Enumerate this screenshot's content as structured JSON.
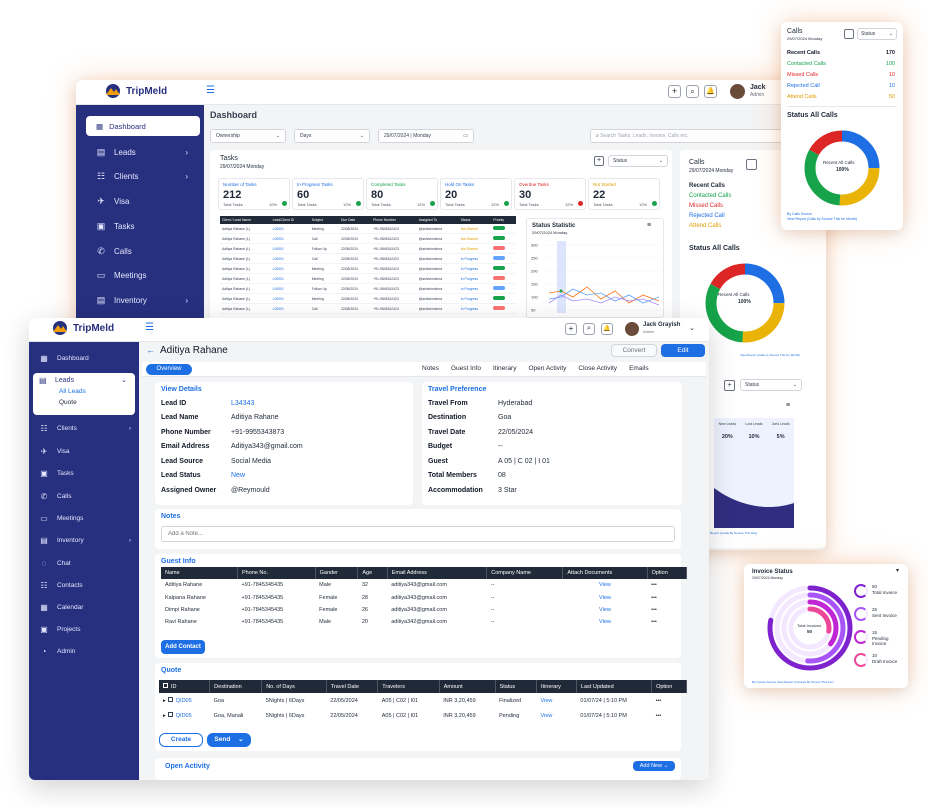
{
  "colors": {
    "sidebar": "#27307f",
    "accent": "#1d6fe3",
    "green": "#16a34a",
    "red": "#dc2626",
    "orange": "#e29b00",
    "yellow": "#eab308"
  },
  "brand": {
    "name": "TripMeld"
  },
  "user": {
    "name": "Jack Grayish",
    "role": "Admin",
    "short_name": "Jack",
    "short_role": "Admin"
  },
  "back_dashboard": {
    "title": "Dashboard",
    "sidebar": [
      "Dashboard",
      "Leads",
      "Clients",
      "Visa",
      "Tasks",
      "Calls",
      "Meetings",
      "Inventory"
    ],
    "filters": {
      "ownership": "Ownership",
      "days": "Days",
      "date": "29/07/2024 | Monday",
      "search_placeholder": "Search Tasks, Leads, Invoice, Calls etc."
    },
    "tasks": {
      "title": "Tasks",
      "date": "29/07/2024 Monday",
      "status_label": "Status",
      "tiles": [
        {
          "label": "Number of Tasks",
          "value": "212",
          "sub": "Total Tasks",
          "pct": "10%"
        },
        {
          "label": "In Progress Tasks",
          "value": "60",
          "sub": "Total Tasks",
          "pct": "12%"
        },
        {
          "label": "Completed Tasks",
          "value": "80",
          "sub": "Total Tasks",
          "pct": "12%"
        },
        {
          "label": "Hold On Tasks",
          "value": "20",
          "sub": "Total Tasks",
          "pct": "12%"
        },
        {
          "label": "Overdue Tasks",
          "value": "30",
          "sub": "Total Tasks",
          "pct": "12%"
        },
        {
          "label": "Not Started",
          "value": "22",
          "sub": "Total Tasks",
          "pct": "12%"
        }
      ],
      "columns": [
        "Client / Lead Name",
        "Lead/Client ID",
        "Subject",
        "Due Date",
        "Phone Number",
        "Assigned To",
        "Status",
        "Priority"
      ],
      "rows": [
        [
          "Aditiya Rahane (L)",
          "L00001",
          "Meeting",
          "22/08/2024",
          "+91-9845342423",
          "@ashishmishra",
          "Not Started"
        ],
        [
          "Aditiya Rahane (L)",
          "L00001",
          "Call",
          "22/08/2024",
          "+91-9845342423",
          "@ashishmishra",
          "Not Started"
        ],
        [
          "Aditiya Rahane (L)",
          "L00001",
          "Follow Up",
          "22/08/2024",
          "+91-9845342423",
          "@ashishmishra",
          "Not Started"
        ],
        [
          "Aditiya Rahane (L)",
          "L00001",
          "Call",
          "22/08/2024",
          "+91-9845342423",
          "@ashishmishra",
          "In Progress"
        ],
        [
          "Aditiya Rahane (L)",
          "L00001",
          "Meeting",
          "22/08/2024",
          "+91-9845342423",
          "@ashishmishra",
          "In Progress"
        ],
        [
          "Aditiya Rahane (L)",
          "L00001",
          "Meeting",
          "22/08/2024",
          "+91-9845342423",
          "@ashishmishra",
          "In Progress"
        ],
        [
          "Aditiya Rahane (L)",
          "L00001",
          "Follow Up",
          "22/08/2024",
          "+91-9845342423",
          "@ashishmishra",
          "In Progress"
        ],
        [
          "Aditiya Rahane (L)",
          "L00001",
          "Meeting",
          "22/08/2024",
          "+91-9845342423",
          "@ashishmishra",
          "In Progress"
        ],
        [
          "Aditiya Rahane (L)",
          "L00001",
          "Call",
          "22/08/2024",
          "+91-9845342423",
          "@ashishmishra",
          "In Progress"
        ]
      ],
      "statistic_title": "Status Statistic",
      "statistic_date": "29/07/2024 Monday",
      "y_ticks": [
        "300",
        "250",
        "200",
        "150",
        "100",
        "50"
      ]
    },
    "calls": {
      "title": "Calls",
      "date": "29/07/2024 Monday",
      "recent": "Recent Calls",
      "contacted": "Contacted Calls",
      "missed": "Missed Calls",
      "rejected": "Rejected Call",
      "attend": "Attend Calls",
      "status_all": "Status All Calls",
      "donut_label": "Recent All Calls",
      "donut_pct": "100%",
      "footnote": "View Report (Calls by Source This for Month)"
    },
    "leads_panel": {
      "status": "Status",
      "cols": [
        {
          "h": "New Leads",
          "v": "20%"
        },
        {
          "h": "Lost Leads",
          "v": "10%"
        },
        {
          "h": "Junk Leads",
          "v": "5%"
        }
      ],
      "footnote": "Report (Leads By Source This Day)"
    }
  },
  "calls_card": {
    "title": "Calls",
    "date": "29/07/2024 Monday",
    "status": "Status",
    "rows": [
      {
        "label": "Recent Calls",
        "value": "170"
      },
      {
        "label": "Contacted Calls",
        "value": "100"
      },
      {
        "label": "Missed Calls",
        "value": "10"
      },
      {
        "label": "Rejected Call",
        "value": "10"
      },
      {
        "label": "Attend Calls",
        "value": "50"
      }
    ],
    "status_all": "Status All Calls",
    "donut_label": "Recent All Calls",
    "donut_pct": "100%",
    "by": "By Calls Source",
    "footnote": "View Report (Calls by Source This for Month)"
  },
  "invoice_card": {
    "title": "Invoice Status",
    "date": "29/07/2024 Monday",
    "center_label": "Total Invoices",
    "center_value": "50",
    "legend": [
      {
        "value": "50",
        "label": "Total Invoice"
      },
      {
        "value": "25",
        "label": "Sent Invoice"
      },
      {
        "value": "15",
        "label": "Pending Invoice"
      },
      {
        "value": "10",
        "label": "Draft Invoice"
      }
    ],
    "footnote": "By Invoice Source  View Report (Invoices By Source This For)"
  },
  "lead_page": {
    "sidebar": [
      {
        "label": "Dashboard",
        "icon": "grid-icon"
      },
      {
        "label": "Leads",
        "icon": "clipboard-icon",
        "sub": [
          "All Leads",
          "Quote"
        ]
      },
      {
        "label": "Clients",
        "icon": "users-icon"
      },
      {
        "label": "Visa",
        "icon": "plane-icon"
      },
      {
        "label": "Tasks",
        "icon": "task-icon"
      },
      {
        "label": "Calls",
        "icon": "phone-icon"
      },
      {
        "label": "Meetings",
        "icon": "monitor-icon"
      },
      {
        "label": "Inventory",
        "icon": "box-icon"
      },
      {
        "label": "Chat",
        "icon": "chat-icon"
      },
      {
        "label": "Contacts",
        "icon": "contacts-icon"
      },
      {
        "label": "Calendar",
        "icon": "calendar-icon"
      },
      {
        "label": "Projects",
        "icon": "projects-icon"
      },
      {
        "label": "Admin",
        "icon": "admin-icon"
      }
    ],
    "title": "Aditiya Rahane",
    "convert": "Convert",
    "edit": "Edit",
    "overview": "Overview",
    "tabs": [
      "Notes",
      "Guest Info",
      "Itinerary",
      "Open Activity",
      "Close Activity",
      "Emails"
    ],
    "view_details": {
      "title": "View Details",
      "rows": [
        {
          "k": "Lead ID",
          "v": "L34343"
        },
        {
          "k": "Lead Name",
          "v": "Aditiya Rahane"
        },
        {
          "k": "Phone Number",
          "v": "+91-9955343873"
        },
        {
          "k": "Email Address",
          "v": "Aditiya343@gmail.com"
        },
        {
          "k": "Lead Source",
          "v": "Social Media"
        },
        {
          "k": "Lead Status",
          "v": "New"
        },
        {
          "k": "Assigned Owner",
          "v": "@Reymould"
        }
      ]
    },
    "travel": {
      "title": "Travel Preference",
      "rows": [
        {
          "k": "Travel From",
          "v": "Hyderabad"
        },
        {
          "k": "Destination",
          "v": "Goa"
        },
        {
          "k": "Travel Date",
          "v": "22/05/2024"
        },
        {
          "k": "Budget",
          "v": "--"
        },
        {
          "k": "Guest",
          "v": "A 05 | C 02 | I 01"
        },
        {
          "k": "Total Members",
          "v": "08"
        },
        {
          "k": "Accommodation",
          "v": "3 Star"
        }
      ]
    },
    "notes": {
      "title": "Notes",
      "placeholder": "Add a Note..."
    },
    "guest": {
      "title": "Guest Info",
      "columns": [
        "Name",
        "Phone No.",
        "Gander",
        "Age",
        "Email Address",
        "Company Name",
        "Attach Documents",
        "Option"
      ],
      "rows": [
        [
          "Aditiya Rahane",
          "+91-7845345435",
          "Male",
          "32",
          "aditiya343@gmail.com",
          "--",
          "View",
          "•••"
        ],
        [
          "Kalpana Rahane",
          "+91-7845345435",
          "Female",
          "28",
          "aditiya343@gmail.com",
          "--",
          "View",
          "•••"
        ],
        [
          "Dimpi Rahane",
          "+91-7845345435",
          "Female",
          "26",
          "aditiya343@gmail.com",
          "--",
          "View",
          "•••"
        ],
        [
          "Ravi Rahane",
          "+91-7845345435",
          "Male",
          "20",
          "aditiya342@gmail.com",
          "--",
          "View",
          "•••"
        ]
      ],
      "add": "Add Contact"
    },
    "quote": {
      "title": "Quote",
      "columns": [
        "ID",
        "Destination",
        "No. of Days",
        "Travel Date",
        "Travelers",
        "Amount",
        "Status",
        "Itinerary",
        "Last Updated",
        "Option"
      ],
      "rows": [
        [
          "QID05",
          "Goa",
          "5Nights | 6Days",
          "22/05/2024",
          "A05 | C02 | I01",
          "INR 3,20,459",
          "Finalized",
          "View",
          "01/07/24 | 5:10 PM",
          "•••"
        ],
        [
          "QID05",
          "Goa, Manali",
          "5Nights | 6Days",
          "22/05/2024",
          "A05 | C02 | I01",
          "INR 3,20,459",
          "Pending",
          "View",
          "01/07/24 | 5:10 PM",
          "•••"
        ]
      ],
      "create": "Create",
      "send": "Send"
    },
    "open_activity": {
      "title": "Open Activity",
      "add_new": "Add New"
    }
  }
}
